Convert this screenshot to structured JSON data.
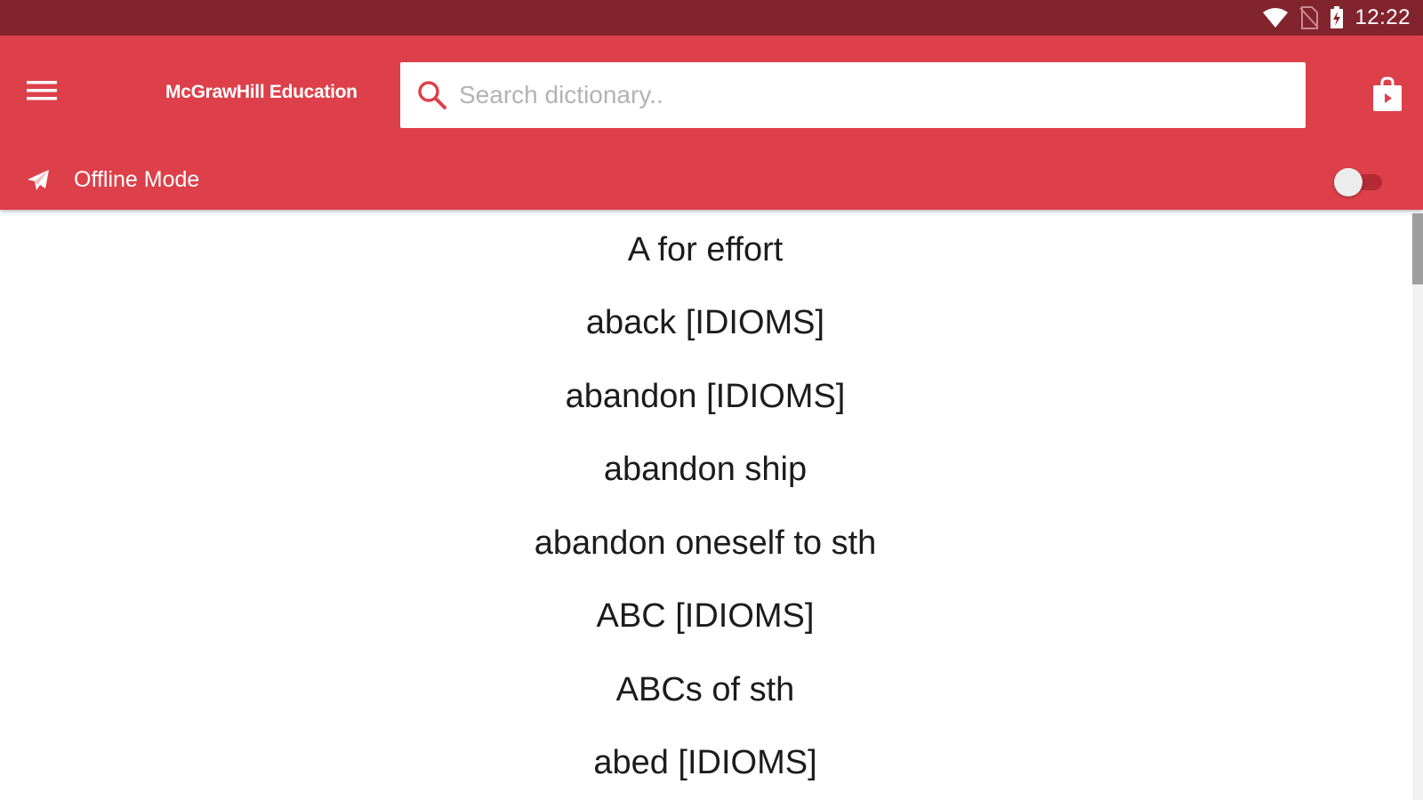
{
  "status_bar": {
    "time": "12:22",
    "icons": [
      "wifi-icon",
      "no-sim-icon",
      "battery-charging-icon"
    ]
  },
  "app_bar": {
    "menu_icon": "hamburger-menu-icon",
    "brand": "McGrawHill Education",
    "search": {
      "icon": "search-icon",
      "placeholder": "Search dictionary..",
      "value": ""
    },
    "store_icon": "store-bag-icon",
    "accent_color": "#dd404a",
    "status_color": "#82242d"
  },
  "offline": {
    "icon": "airplane-icon",
    "label": "Offline Mode",
    "enabled": false
  },
  "entries": [
    "A for effort",
    "aback [IDIOMS]",
    "abandon [IDIOMS]",
    "abandon ship",
    "abandon oneself to sth",
    "ABC [IDIOMS]",
    "ABCs of sth",
    "abed [IDIOMS]"
  ]
}
